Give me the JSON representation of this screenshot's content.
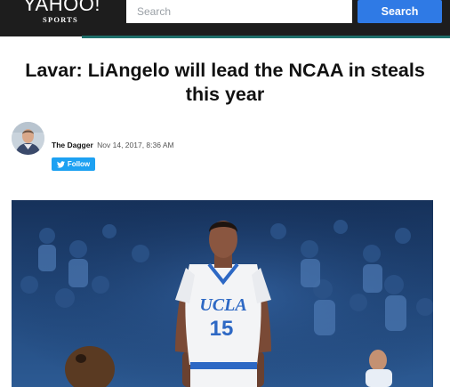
{
  "header": {
    "logo_main": "YAHOO!",
    "logo_sub": "SPORTS",
    "search_placeholder": "Search",
    "search_button_label": "Search"
  },
  "article": {
    "headline": "Lavar: LiAngelo will lead the NCAA in steals this year",
    "author": "The Dagger",
    "timestamp": "Nov 14, 2017, 8:36 AM",
    "follow_label": "Follow",
    "photo": {
      "jersey_team": "UCLA",
      "jersey_number": "15"
    }
  },
  "colors": {
    "topbar": "#1d1d1d",
    "search_button": "#2f7ae5",
    "follow_button": "#1da1f2",
    "jersey_blue": "#2d68c4"
  },
  "icons": {
    "follow": "twitter-bird-icon"
  }
}
